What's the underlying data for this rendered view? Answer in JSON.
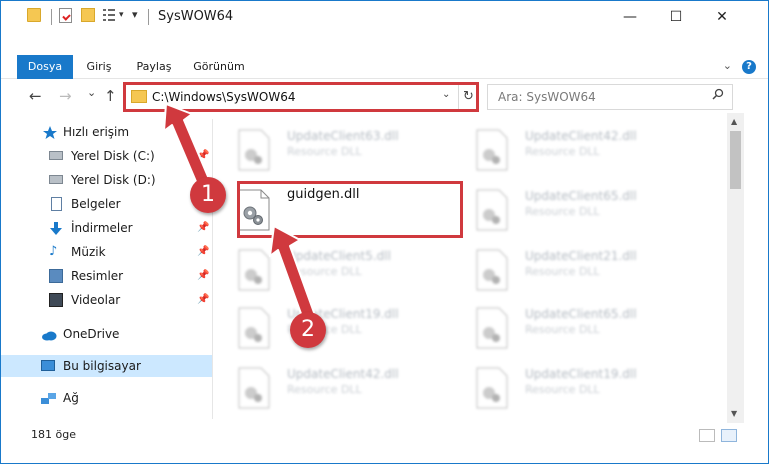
{
  "window": {
    "title": "SysWOW64",
    "minimize": "—",
    "maximize": "☐",
    "close": "✕"
  },
  "ribbon": {
    "tabs": [
      {
        "label": "Dosya",
        "active": true
      },
      {
        "label": "Giriş"
      },
      {
        "label": "Paylaş"
      },
      {
        "label": "Görünüm"
      }
    ]
  },
  "nav": {
    "back": "←",
    "forward": "→",
    "recent": "⌄",
    "up": "↑"
  },
  "address": {
    "path": "C:\\Windows\\SysWOW64",
    "dropdown": "⌄",
    "refresh": "↻"
  },
  "search": {
    "placeholder": "Ara: SysWOW64",
    "icon": "⚲"
  },
  "sidebar": {
    "items": [
      {
        "label": "Hızlı erişim",
        "icon": "star-icon",
        "pinned": false
      },
      {
        "label": "Yerel Disk (C:)",
        "icon": "drive-icon",
        "pinned": true
      },
      {
        "label": "Yerel Disk (D:)",
        "icon": "drive-icon",
        "pinned": true
      },
      {
        "label": "Belgeler",
        "icon": "documents-icon",
        "pinned": true
      },
      {
        "label": "İndirmeler",
        "icon": "downloads-icon",
        "pinned": true
      },
      {
        "label": "Müzik",
        "icon": "music-icon",
        "pinned": true
      },
      {
        "label": "Resimler",
        "icon": "pictures-icon",
        "pinned": true
      },
      {
        "label": "Videolar",
        "icon": "videos-icon",
        "pinned": true
      },
      {
        "label": "OneDrive",
        "icon": "cloud-icon",
        "pinned": false
      },
      {
        "label": "Bu bilgisayar",
        "icon": "computer-icon",
        "pinned": false,
        "selected": true
      },
      {
        "label": "Ağ",
        "icon": "network-icon",
        "pinned": false
      }
    ]
  },
  "files": [
    {
      "name": "UpdateClient63.dll",
      "type": "Resource DLL"
    },
    {
      "name": "UpdateClient42.dll",
      "type": "Resource DLL"
    },
    {
      "name": "guidgen.dll",
      "type": ""
    },
    {
      "name": "UpdateClient65.dll",
      "type": "Resource DLL"
    },
    {
      "name": "UpdateClient5.dll",
      "type": "Resource DLL"
    },
    {
      "name": "UpdateClient21.dll",
      "type": "Resource DLL"
    },
    {
      "name": "UpdateClient19.dll",
      "type": "Resource DLL"
    },
    {
      "name": "UpdateClient65.dll",
      "type": "Resource DLL"
    },
    {
      "name": "UpdateClient42.dll",
      "type": "Resource DLL"
    },
    {
      "name": "UpdateClient19.dll",
      "type": "Resource DLL"
    }
  ],
  "status": {
    "item_count": "181 öge"
  },
  "annotations": {
    "step1": "1",
    "step2": "2",
    "color": "#d0393e"
  },
  "colors": {
    "accent": "#1979ca",
    "selected_bg": "#cce8ff",
    "highlight": "#d0393e"
  }
}
